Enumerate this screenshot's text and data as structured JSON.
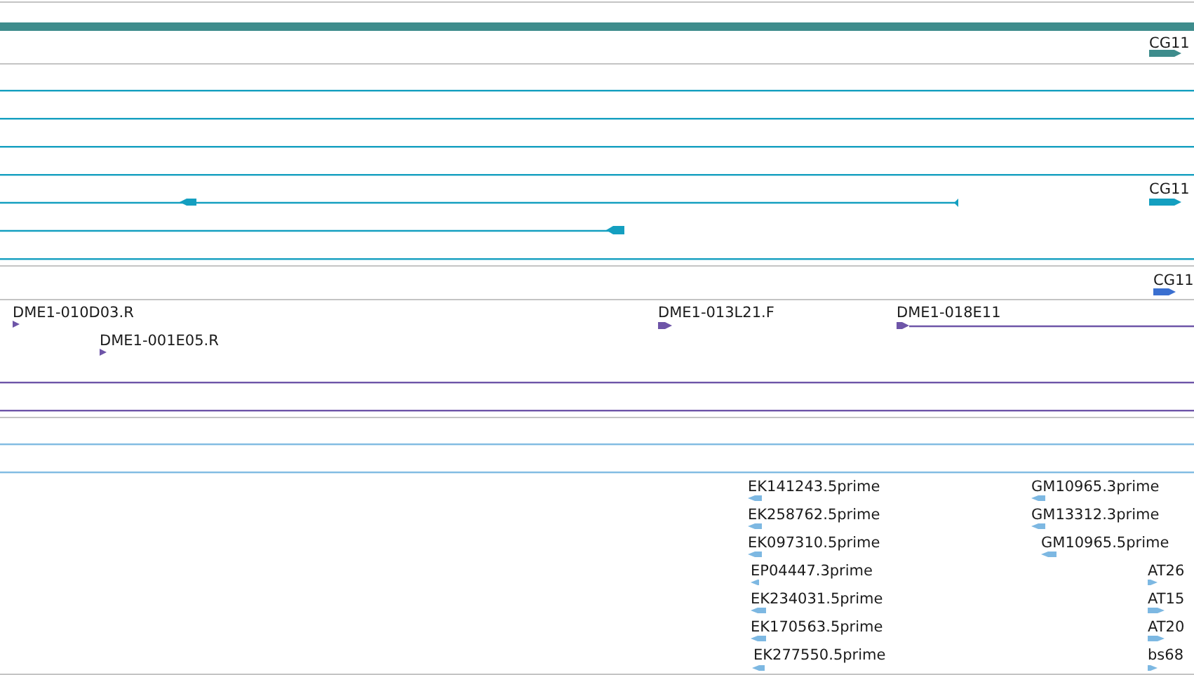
{
  "tracks": [
    {
      "color": "#3e8c8c",
      "features": [
        {
          "kind": "bar"
        },
        {
          "kind": "arrow",
          "label": "CG11",
          "reverse": false
        }
      ]
    },
    {
      "color": "#149fc0",
      "features": [
        {
          "kind": "line"
        },
        {
          "kind": "line"
        },
        {
          "kind": "line"
        },
        {
          "kind": "line"
        },
        {
          "kind": "transcript",
          "reverse": true
        },
        {
          "kind": "arrow",
          "label": "CG11",
          "reverse": false
        },
        {
          "kind": "transcript",
          "reverse": true
        },
        {
          "kind": "line"
        }
      ]
    },
    {
      "color": "#3a6fd0",
      "features": [
        {
          "kind": "arrow",
          "label": "CG11",
          "reverse": false
        }
      ]
    },
    {
      "color": "#6e55a8",
      "features": [
        {
          "kind": "arrow",
          "label": "DME1-010D03.R",
          "reverse": false
        },
        {
          "kind": "arrow",
          "label": "DME1-001E05.R",
          "reverse": false
        },
        {
          "kind": "arrow",
          "label": "DME1-013L21.F",
          "reverse": false
        },
        {
          "kind": "transcript",
          "label": "DME1-018E11",
          "reverse": false
        },
        {
          "kind": "line"
        },
        {
          "kind": "line"
        }
      ]
    },
    {
      "color": "#80bbe2",
      "features": [
        {
          "kind": "line"
        },
        {
          "kind": "line"
        }
      ]
    },
    {
      "color": "#7db8e2",
      "features": [
        {
          "kind": "arrow",
          "label": "EK141243.5prime",
          "reverse": true
        },
        {
          "kind": "arrow",
          "label": "EK258762.5prime",
          "reverse": true
        },
        {
          "kind": "arrow",
          "label": "EK097310.5prime",
          "reverse": true
        },
        {
          "kind": "arrow",
          "label": "EP04447.3prime",
          "reverse": true
        },
        {
          "kind": "arrow",
          "label": "EK234031.5prime",
          "reverse": true
        },
        {
          "kind": "arrow",
          "label": "EK170563.5prime",
          "reverse": true
        },
        {
          "kind": "arrow",
          "label": "EK277550.5prime",
          "reverse": true
        },
        {
          "kind": "arrow",
          "label": "GM10965.3prime",
          "reverse": true
        },
        {
          "kind": "arrow",
          "label": "GM13312.3prime",
          "reverse": true
        },
        {
          "kind": "arrow",
          "label": "GM10965.5prime",
          "reverse": true
        },
        {
          "kind": "arrow",
          "label": "AT26",
          "reverse": false
        },
        {
          "kind": "arrow",
          "label": "AT15",
          "reverse": false
        },
        {
          "kind": "arrow",
          "label": "AT20",
          "reverse": false
        },
        {
          "kind": "arrow",
          "label": "bs68",
          "reverse": false
        }
      ]
    }
  ]
}
